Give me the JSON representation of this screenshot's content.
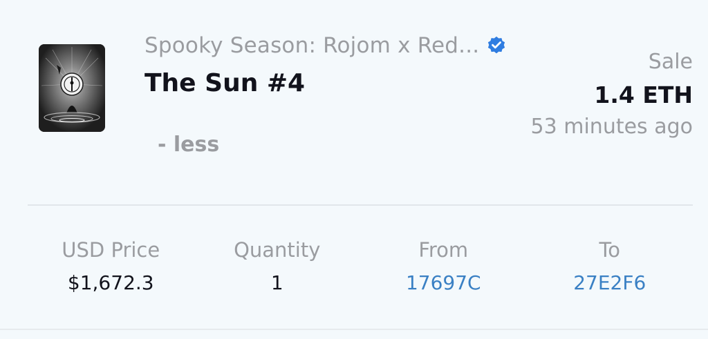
{
  "item": {
    "collection_name": "Spooky Season: Rojom x Red...",
    "name": "The Sun #4",
    "toggle_label": "- less"
  },
  "sale": {
    "label": "Sale",
    "price": "1.4 ETH",
    "time_ago": "53 minutes ago"
  },
  "stats": {
    "usd_price": {
      "label": "USD Price",
      "value": "$1,672.3"
    },
    "quantity": {
      "label": "Quantity",
      "value": "1"
    },
    "from": {
      "label": "From",
      "value": "17697C"
    },
    "to": {
      "label": "To",
      "value": "27E2F6"
    }
  },
  "icons": {
    "verified": "verified-check-badge-icon"
  },
  "colors": {
    "background": "#f4f9fc",
    "muted_text": "#9a9ca0",
    "primary_text": "#12131c",
    "link": "#3a80c4",
    "verified_badge": "#2f7de1"
  }
}
